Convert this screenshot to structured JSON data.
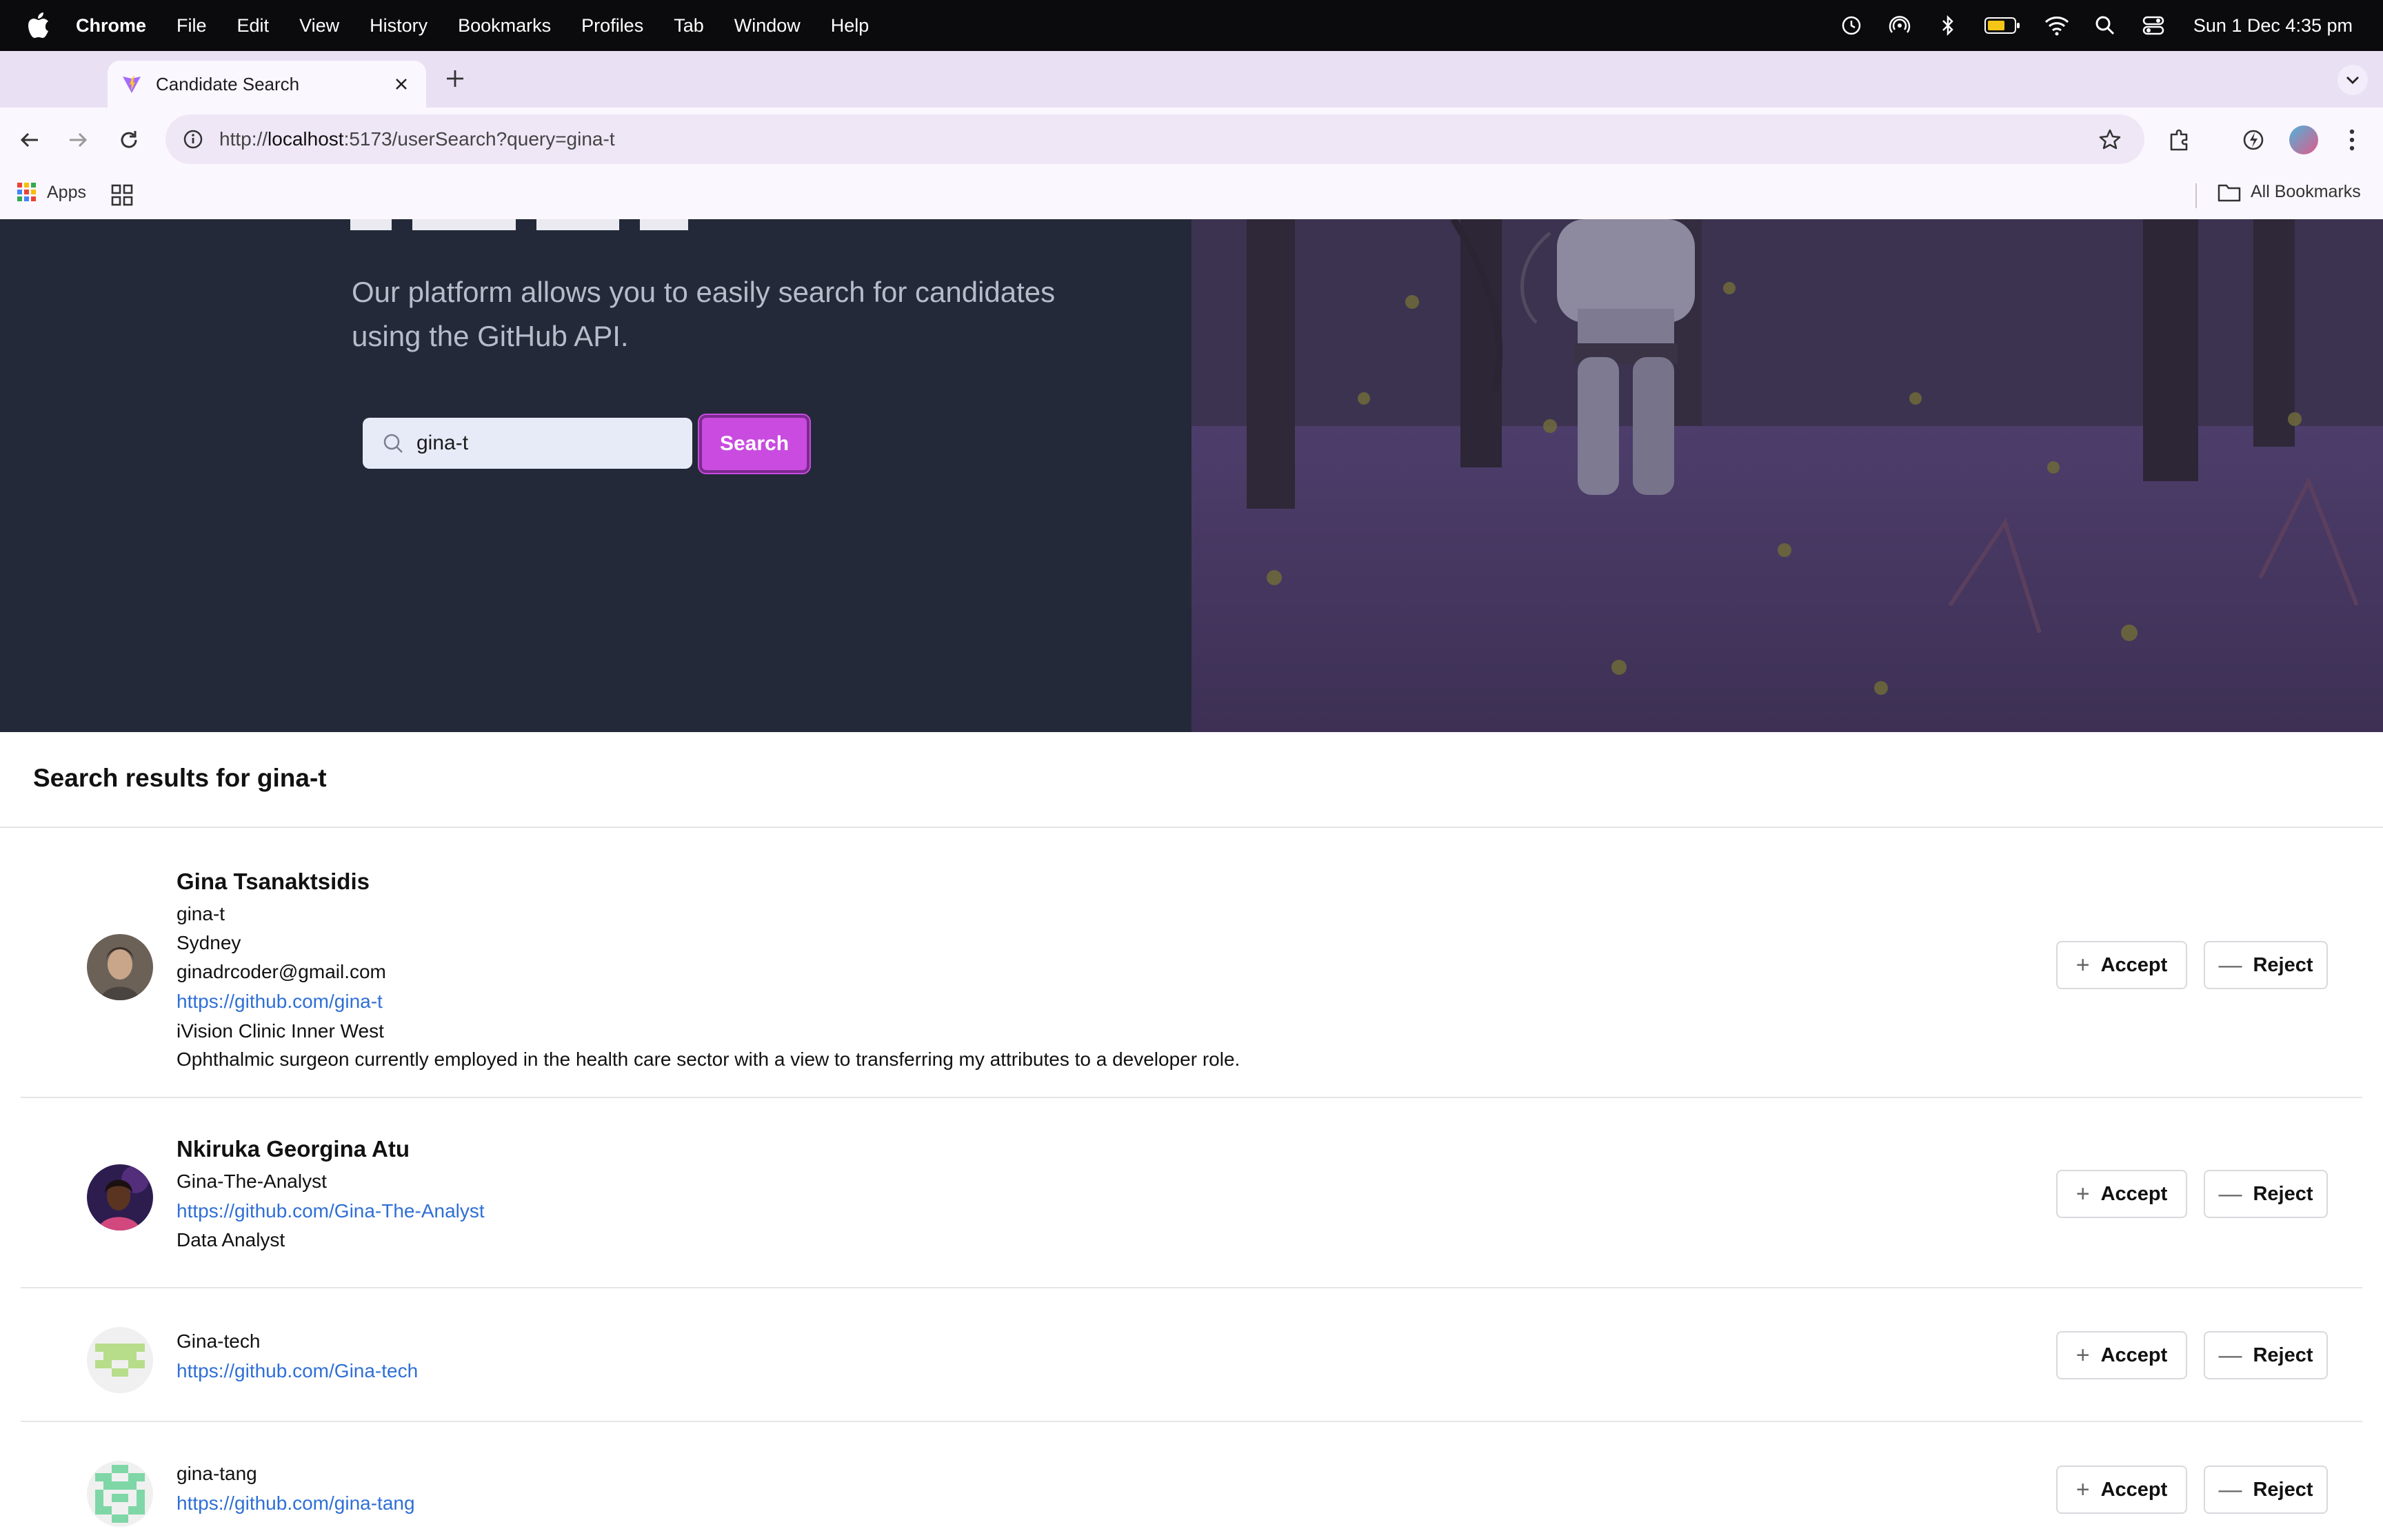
{
  "menubar": {
    "app": "Chrome",
    "items": [
      "File",
      "Edit",
      "View",
      "History",
      "Bookmarks",
      "Profiles",
      "Tab",
      "Window",
      "Help"
    ],
    "clock": "Sun 1 Dec  4:35 pm"
  },
  "browser": {
    "tab_title": "Candidate Search",
    "url_prefix": "http://",
    "url_host": "localhost",
    "url_rest": ":5173/userSearch?query=gina-t",
    "bookmarks": {
      "apps_label": "Apps",
      "all_label": "All Bookmarks"
    }
  },
  "hero": {
    "subtitle": "Our platform allows you to easily search for candidates using the GitHub API.",
    "search_value": "gina-t",
    "search_button": "Search"
  },
  "results": {
    "title": "Search results for gina-t",
    "accept_label": "Accept",
    "reject_label": "Reject",
    "candidates": [
      {
        "name": "Gina Tsanaktsidis",
        "login": "gina-t",
        "location": "Sydney",
        "email": "ginadrcoder@gmail.com",
        "url": "https://github.com/gina-t",
        "company": "iVision Clinic Inner West",
        "bio": "Ophthalmic surgeon currently employed in the health care sector with a view to transferring my attributes to a developer role."
      },
      {
        "name": "Nkiruka Georgina Atu",
        "login": "Gina-The-Analyst",
        "url": "https://github.com/Gina-The-Analyst",
        "bio": "Data Analyst"
      },
      {
        "login": "Gina-tech",
        "url": "https://github.com/Gina-tech"
      },
      {
        "login": "gina-tang",
        "url": "https://github.com/gina-tang"
      }
    ]
  },
  "colors": {
    "accent": "#c94be0",
    "link": "#2f6fd6",
    "hero_bg": "#232938"
  }
}
